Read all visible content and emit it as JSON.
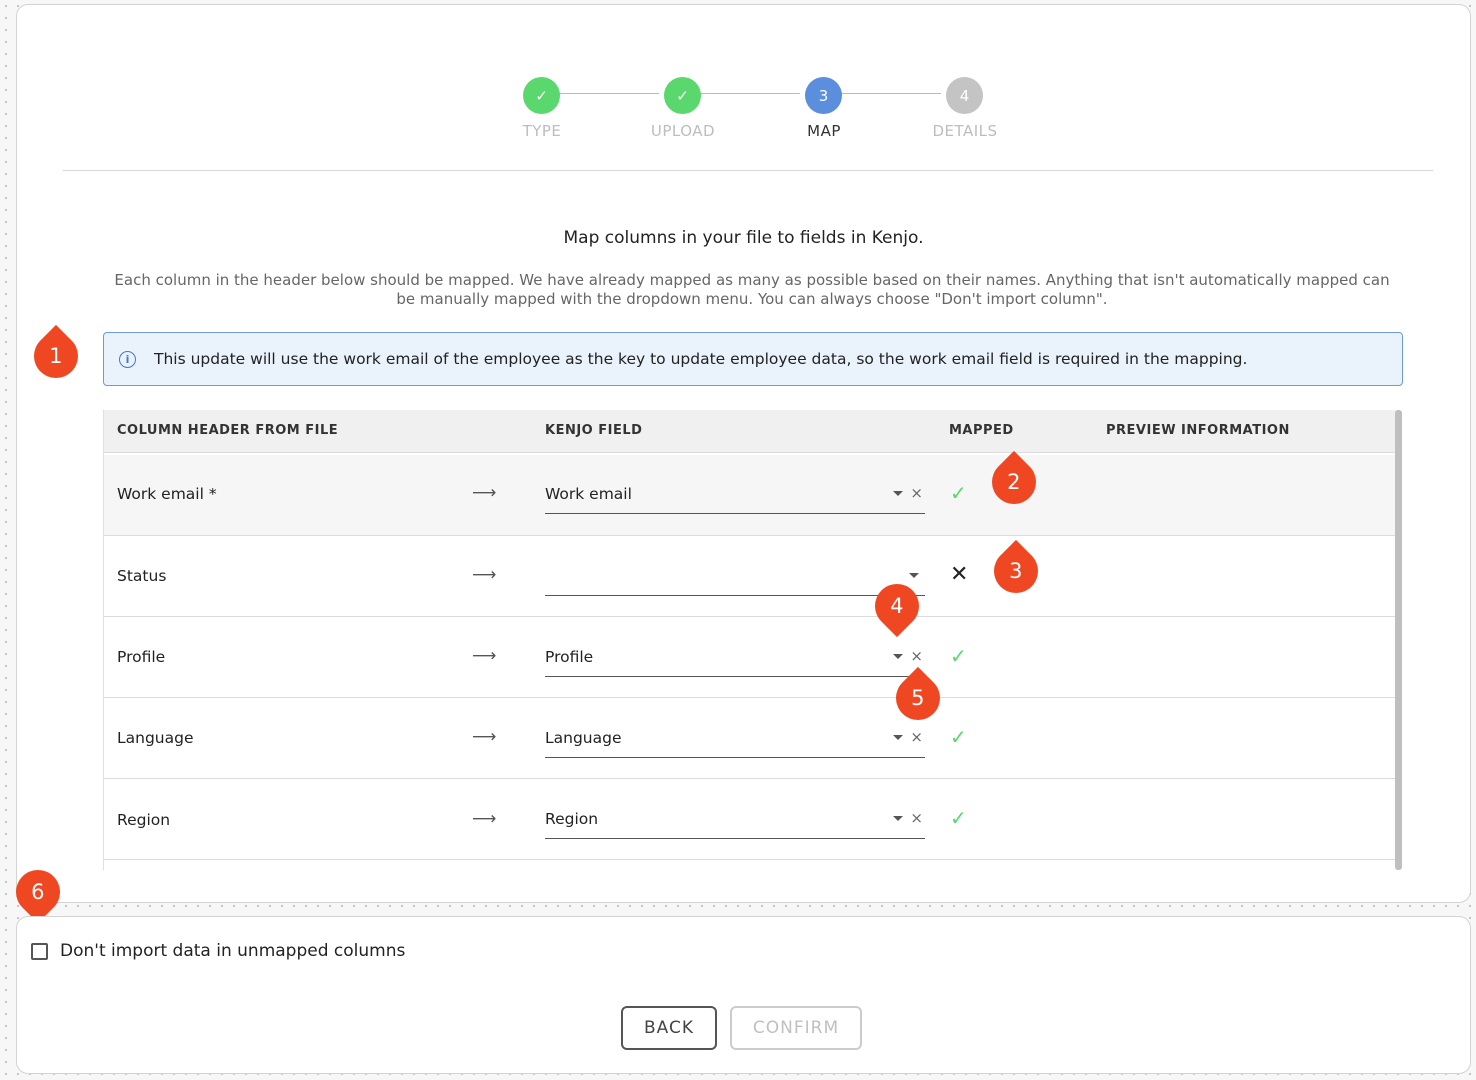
{
  "stepper": {
    "steps": [
      {
        "label": "TYPE",
        "state": "done",
        "marker": "✓"
      },
      {
        "label": "UPLOAD",
        "state": "done",
        "marker": "✓"
      },
      {
        "label": "MAP",
        "state": "active",
        "marker": "3"
      },
      {
        "label": "DETAILS",
        "state": "todo",
        "marker": "4"
      }
    ]
  },
  "heading": "Map columns in your file to fields in Kenjo.",
  "description": "Each column in the header below should be mapped. We have already mapped as many as possible based on their names. Anything that isn't automatically mapped can be manually mapped with the dropdown menu. You can always choose \"Don't import column\".",
  "info": {
    "icon": "info-icon",
    "glyph": "i",
    "text": "This update will use the work email of the employee as the key to update employee data, so the work email field is required in the mapping."
  },
  "table": {
    "headers": [
      "COLUMN HEADER FROM FILE",
      "KENJO FIELD",
      "MAPPED",
      "PREVIEW INFORMATION"
    ],
    "rows": [
      {
        "column": "Work email *",
        "arrow": "⟶",
        "field": "Work email",
        "mapped": true,
        "mark": "✓",
        "clear": "×"
      },
      {
        "column": "Status",
        "arrow": "⟶",
        "field": "",
        "mapped": false,
        "mark": "✕",
        "clear": ""
      },
      {
        "column": "Profile",
        "arrow": "⟶",
        "field": "Profile",
        "mapped": true,
        "mark": "✓",
        "clear": "×"
      },
      {
        "column": "Language",
        "arrow": "⟶",
        "field": "Language",
        "mapped": true,
        "mark": "✓",
        "clear": "×"
      },
      {
        "column": "Region",
        "arrow": "⟶",
        "field": "Region",
        "mapped": true,
        "mark": "✓",
        "clear": "×"
      }
    ]
  },
  "annotations": [
    "1",
    "2",
    "3",
    "4",
    "5",
    "6"
  ],
  "footer": {
    "checkbox_label": "Don't import data in unmapped columns",
    "back_label": "BACK",
    "confirm_label": "CONFIRM"
  },
  "colors": {
    "done": "#5ad86e",
    "active": "#5b8fde",
    "todo": "#c4c4c4",
    "annotation": "#f04723",
    "info_border": "#6d9ad8"
  }
}
